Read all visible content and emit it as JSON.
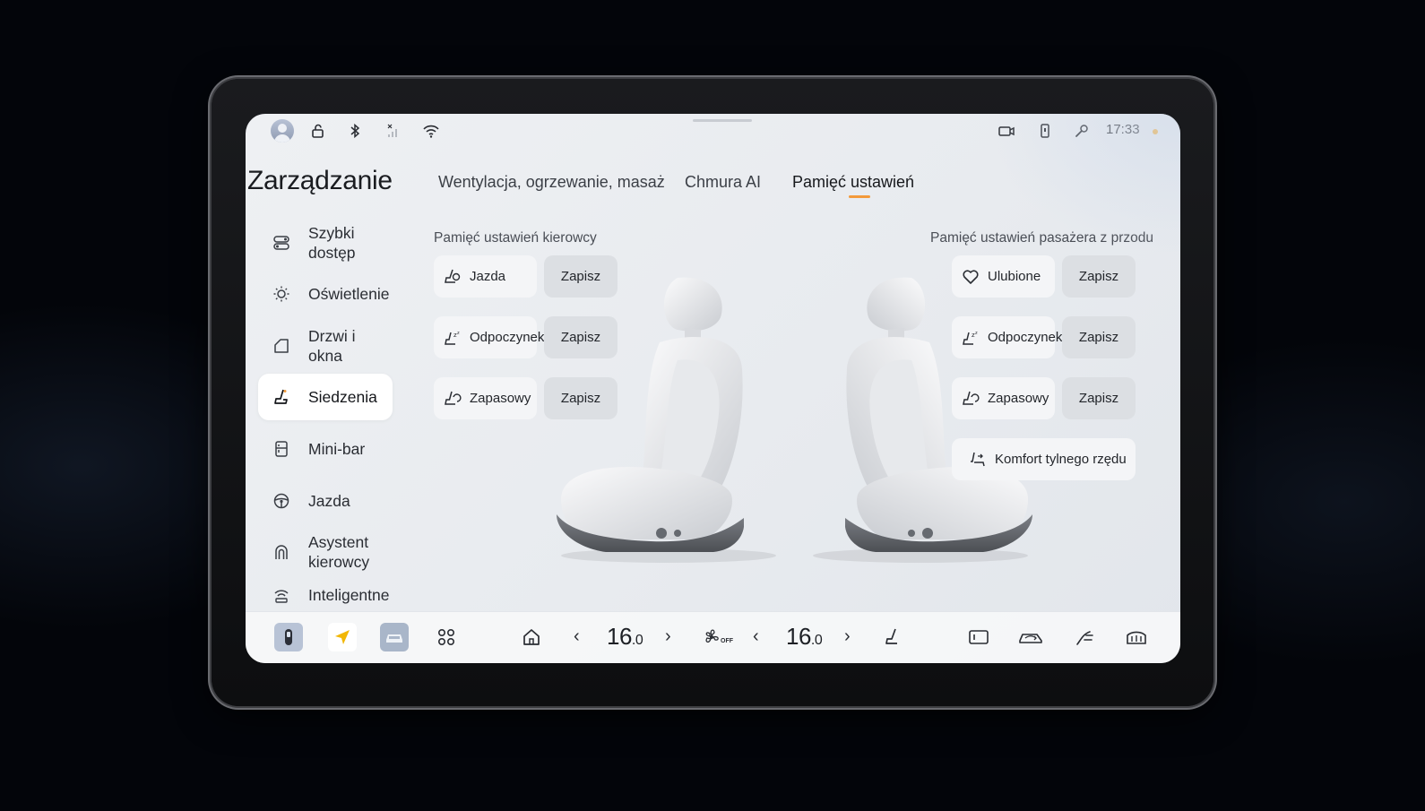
{
  "status_bar": {
    "time": "17:33",
    "icons": [
      "avatar",
      "unlock-icon",
      "bluetooth-icon",
      "no-signal-icon",
      "wifi-icon",
      "dashcam-icon",
      "phone-key-icon",
      "wrench-icon",
      "notification-dot"
    ]
  },
  "header": {
    "title": "Zarządzanie"
  },
  "tabs": [
    {
      "label": "Wentylacja, ogrzewanie, masaż",
      "active": false
    },
    {
      "label": "Chmura AI",
      "active": false
    },
    {
      "label": "Pamięć ustawień",
      "active": true
    }
  ],
  "sidebar": {
    "items": [
      {
        "label": "Szybki dostęp",
        "icon": "toggles-icon"
      },
      {
        "label": "Oświetlenie",
        "icon": "light-icon"
      },
      {
        "label": "Drzwi i okna",
        "icon": "door-icon"
      },
      {
        "label": "Siedzenia",
        "icon": "seat-icon",
        "active": true
      },
      {
        "label": "Mini-bar",
        "icon": "fridge-icon"
      },
      {
        "label": "Jazda",
        "icon": "steering-wheel-icon"
      },
      {
        "label": "Asystent kierowcy",
        "icon": "assist-icon"
      },
      {
        "label": "Inteligentne",
        "icon": "smart-icon"
      }
    ]
  },
  "driver": {
    "title": "Pamięć ustawień kierowcy",
    "presets": [
      {
        "label": "Jazda",
        "icon": "seat-drive-icon",
        "save": "Zapisz"
      },
      {
        "label": "Odpoczynek",
        "icon": "seat-rest-icon",
        "save": "Zapisz"
      },
      {
        "label": "Zapasowy",
        "icon": "seat-spare-icon",
        "save": "Zapisz"
      }
    ]
  },
  "passenger": {
    "title": "Pamięć ustawień pasażera z przodu",
    "presets": [
      {
        "label": "Ulubione",
        "icon": "heart-icon",
        "save": "Zapisz"
      },
      {
        "label": "Odpoczynek",
        "icon": "seat-rest-icon",
        "save": "Zapisz"
      },
      {
        "label": "Zapasowy",
        "icon": "seat-spare-icon",
        "save": "Zapisz"
      }
    ],
    "rear_comfort": "Komfort tylnego rzędu"
  },
  "dock": {
    "left_temp": "16.0",
    "right_temp": "16.0",
    "left_temp_int": "16",
    "left_temp_dec": ".0",
    "right_temp_int": "16",
    "right_temp_dec": ".0",
    "fan_label": "OFF",
    "accent": "#f39a3b"
  }
}
